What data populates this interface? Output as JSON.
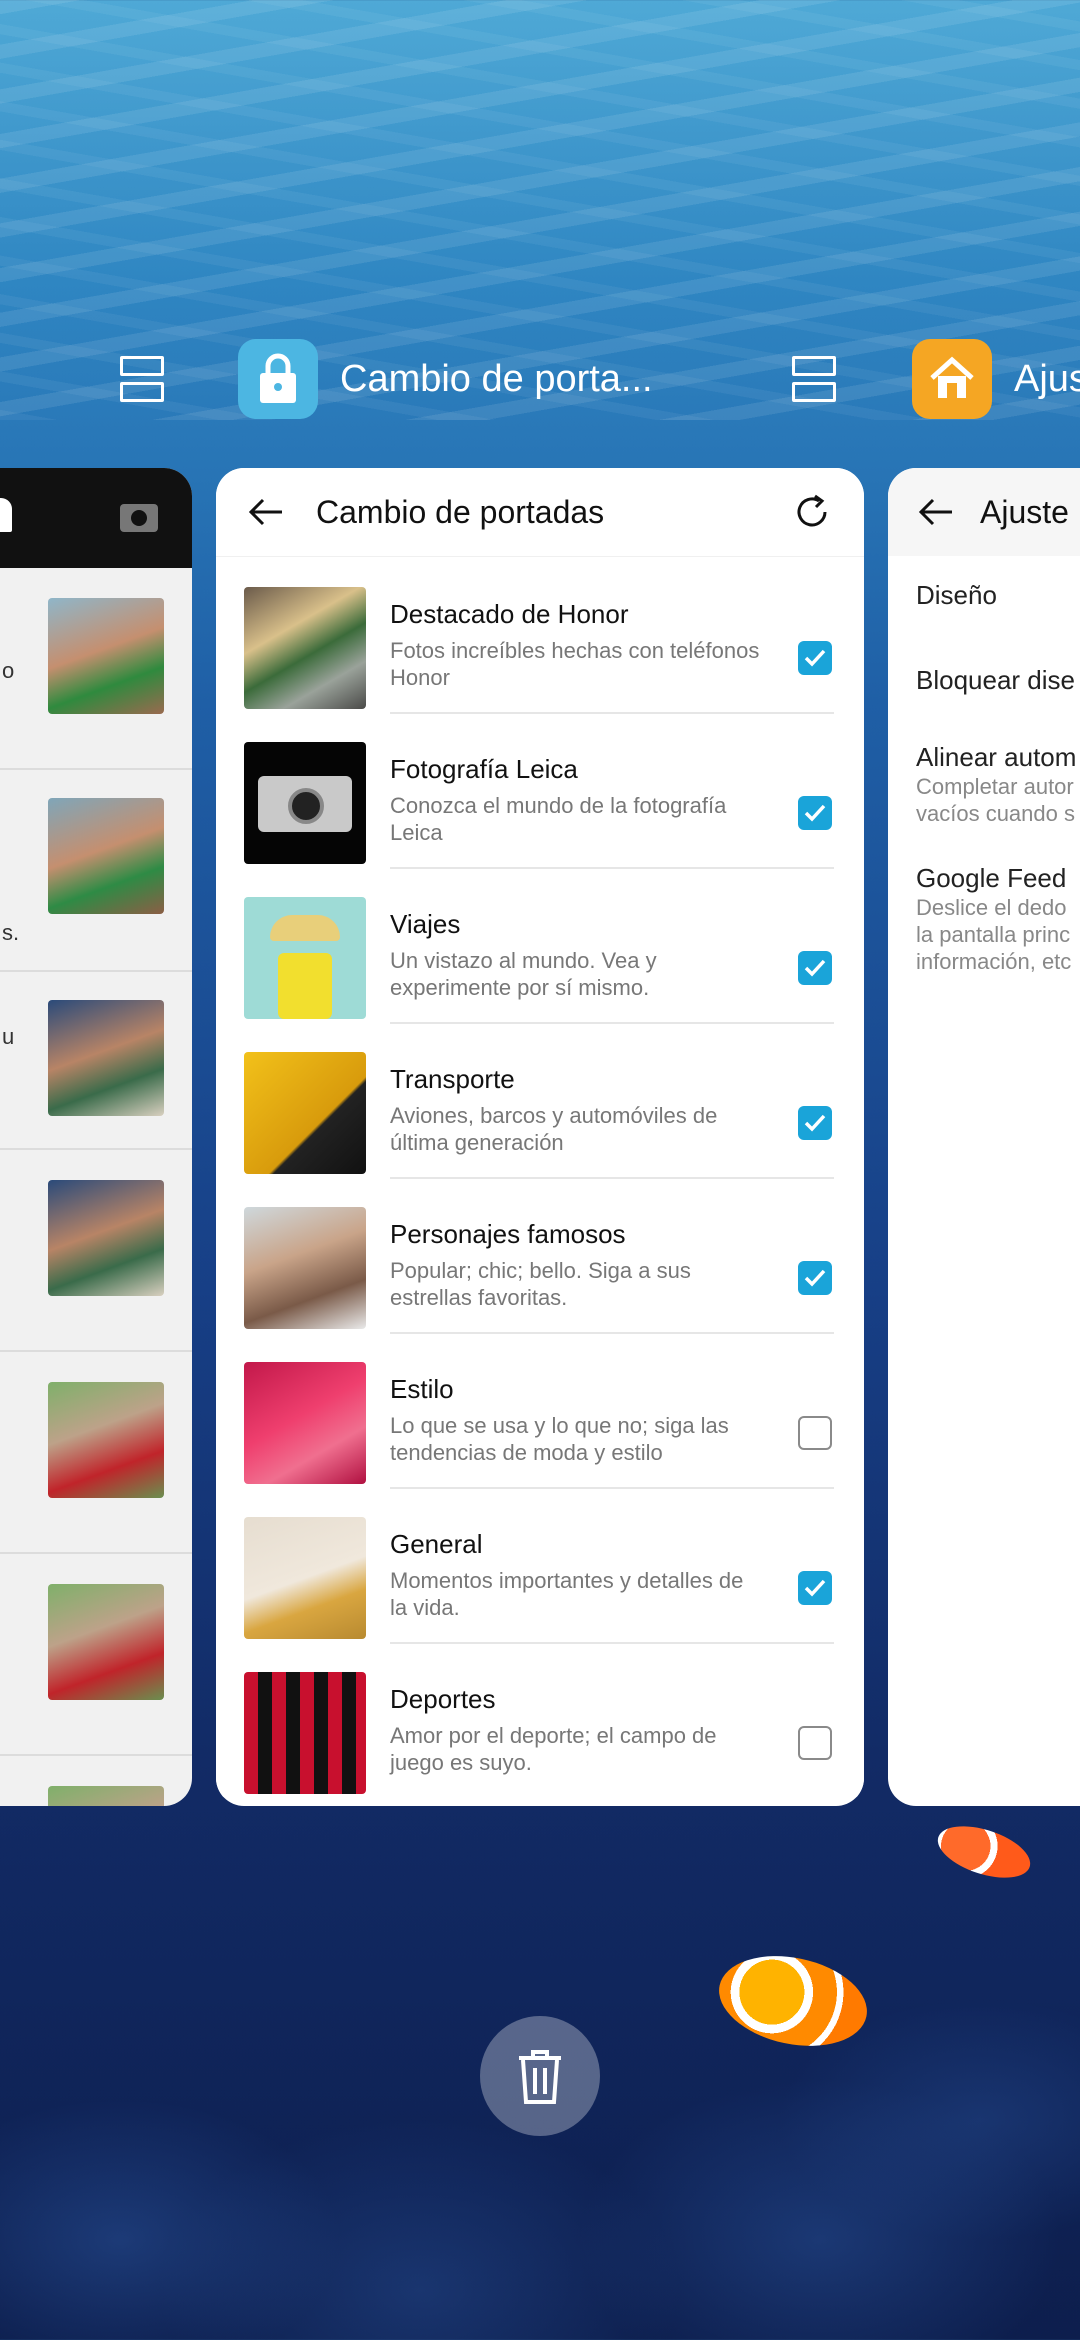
{
  "recents": {
    "main_app": {
      "title": "Cambio de porta...",
      "icon": "lock-icon",
      "icon_color": "#4cb6e2"
    },
    "right_app": {
      "title": "Ajus",
      "icon": "home-icon",
      "icon_color": "#f5a623"
    }
  },
  "main_card": {
    "title": "Cambio de portadas",
    "back_icon": "arrow-left-icon",
    "refresh_icon": "refresh-icon",
    "items": [
      {
        "title": "Destacado de Honor",
        "desc": "Fotos increíbles hechas con teléfonos Honor",
        "checked": true
      },
      {
        "title": "Fotografía Leica",
        "desc": "Conozca el mundo de la fotografía Leica",
        "checked": true
      },
      {
        "title": "Viajes",
        "desc": "Un vistazo al mundo. Vea y experimente por sí mismo.",
        "checked": true
      },
      {
        "title": "Transporte",
        "desc": "Aviones, barcos y automóviles de última generación",
        "checked": true
      },
      {
        "title": "Personajes famosos",
        "desc": "Popular; chic; bello. Siga a sus estrellas favoritas.",
        "checked": true
      },
      {
        "title": "Estilo",
        "desc": "Lo que se usa y lo que no; siga las tendencias de moda y estilo",
        "checked": false
      },
      {
        "title": "General",
        "desc": "Momentos importantes y detalles de la vida.",
        "checked": true
      },
      {
        "title": "Deportes",
        "desc": "Amor por el deporte; el campo de juego es suyo.",
        "checked": false
      }
    ]
  },
  "right_card": {
    "title": "Ajuste",
    "items": [
      {
        "title": "Diseño",
        "desc": ""
      },
      {
        "title": "Bloquear dise",
        "desc": ""
      },
      {
        "title": "Alinear autom",
        "desc": "Completar autor vacíos cuando s"
      },
      {
        "title": "Google Feed",
        "desc": "Deslice el dedo la pantalla princ información, etc"
      }
    ]
  },
  "left_card": {
    "left_edge_chars": [
      "o",
      "",
      "s.",
      "u",
      "",
      "",
      "",
      ""
    ]
  },
  "colors": {
    "accent": "#1aa4d9"
  }
}
